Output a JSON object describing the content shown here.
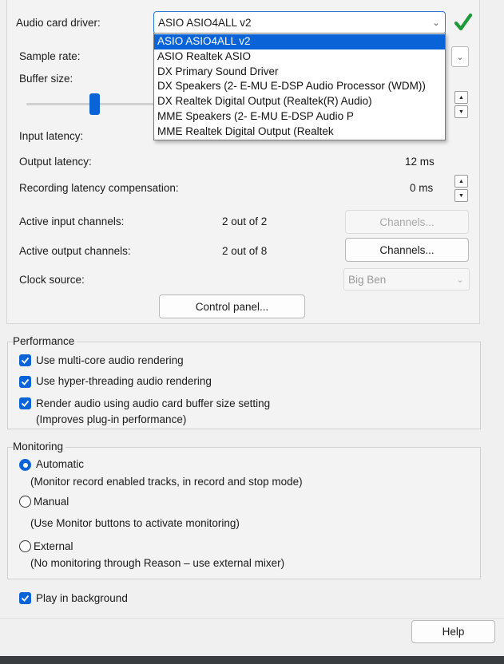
{
  "audio": {
    "driver_label": "Audio card driver:",
    "driver_value": "ASIO ASIO4ALL v2",
    "driver_options": [
      "ASIO ASIO4ALL v2",
      "ASIO Realtek ASIO",
      "DX Primary Sound Driver",
      "DX Speakers (2- E-MU E-DSP Audio Processor (WDM))",
      "DX Realtek Digital Output (Realtek(R) Audio)",
      "MME Speakers (2- E-MU E-DSP Audio P",
      "MME Realtek Digital Output (Realtek"
    ],
    "selected_option_index": 0,
    "sample_rate_label": "Sample rate:",
    "buffer_size_label": "Buffer size:",
    "input_latency_label": "Input latency:",
    "output_latency_label": "Output latency:",
    "output_latency_value": "12 ms",
    "rec_comp_label": "Recording latency compensation:",
    "rec_comp_value": "0 ms",
    "active_input_label": "Active input channels:",
    "active_input_value": "2 out of 2",
    "active_output_label": "Active output channels:",
    "active_output_value": "2 out of 8",
    "channels_button_label": "Channels...",
    "clock_source_label": "Clock source:",
    "clock_source_value": "Big Ben",
    "control_panel_label": "Control panel..."
  },
  "performance": {
    "title": "Performance",
    "items": [
      {
        "label": "Use multi-core audio rendering",
        "checked": true
      },
      {
        "label": "Use hyper-threading audio rendering",
        "checked": true
      },
      {
        "label": "Render audio using audio card buffer size setting",
        "checked": true
      }
    ],
    "render_note": "(Improves plug-in performance)"
  },
  "monitoring": {
    "title": "Monitoring",
    "automatic_label": "Automatic",
    "automatic_note": "(Monitor record enabled tracks, in record and stop mode)",
    "manual_label": "Manual",
    "manual_note": "(Use Monitor buttons to activate monitoring)",
    "external_label": "External",
    "external_note": "(No monitoring through Reason – use external mixer)",
    "selected": "Automatic"
  },
  "play_in_background_label": "Play in background",
  "help_label": "Help",
  "colors": {
    "accent": "#0a64d8",
    "check_green": "#1f9a3a"
  }
}
